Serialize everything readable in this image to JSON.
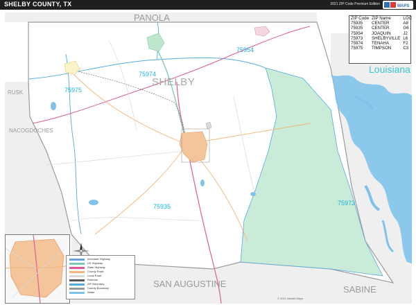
{
  "header": {
    "title": "SHELBY COUNTY, TX",
    "edition": "2021 ZIP Code Premium Edition",
    "logo_text": "Market MAPS"
  },
  "map": {
    "county_label": "SHELBY",
    "neighbors": {
      "panola": "PANOLA",
      "rusk": "RUSK",
      "nacogdoches": "NACOGDOCHES",
      "san_augustine": "SAN AUGUSTINE",
      "sabine": "SABINE"
    },
    "state_label": "Louisiana",
    "zip_labels": {
      "z75954": "75954",
      "z75974": "75974",
      "z75975": "75975",
      "z75935": "75935",
      "z75973": "75973"
    },
    "colors": {
      "water": "#7fc3ea",
      "sabine_zone": "#c9ebd7",
      "center_city": "#f4c59b",
      "joaquin_city": "#bfe7cf",
      "tenaha_city": "#f2d7e2",
      "timpson_city": "#faf2c9",
      "neighbor_fill": "#efefef",
      "county_line": "#9a9a9a",
      "zip_line": "#55aadd",
      "highway": "#e05b9a",
      "road": "#f1b67a"
    }
  },
  "zip_table": {
    "headers": [
      "ZIP Code",
      "ZIP Name",
      "LOC"
    ],
    "rows": [
      [
        "75935",
        "CENTER",
        "A8"
      ],
      [
        "75935",
        "CENTER",
        "G6"
      ],
      [
        "75954",
        "JOAQUIN",
        "J2"
      ],
      [
        "75973",
        "SHELBYVILLE",
        "L6"
      ],
      [
        "75974",
        "TENAHA",
        "F2"
      ],
      [
        "75975",
        "TIMPSON",
        "C3"
      ]
    ]
  },
  "legend": {
    "items": [
      {
        "label": "Interstate Highway",
        "color": "#6aa0d8"
      },
      {
        "label": "US Highway",
        "color": "#7cc8b8"
      },
      {
        "label": "State Highway",
        "color": "#e05b9a"
      },
      {
        "label": "County Road",
        "color": "#f1b67a"
      },
      {
        "label": "Local Road",
        "color": "#d9d9d9"
      },
      {
        "label": "Railroad",
        "color": "#555555"
      },
      {
        "label": "ZIP Boundary",
        "color": "#55aadd"
      },
      {
        "label": "County Boundary",
        "color": "#9a9a9a"
      },
      {
        "label": "Water",
        "color": "#7fc3ea"
      }
    ]
  },
  "copyright": "© 2021 Market Maps"
}
